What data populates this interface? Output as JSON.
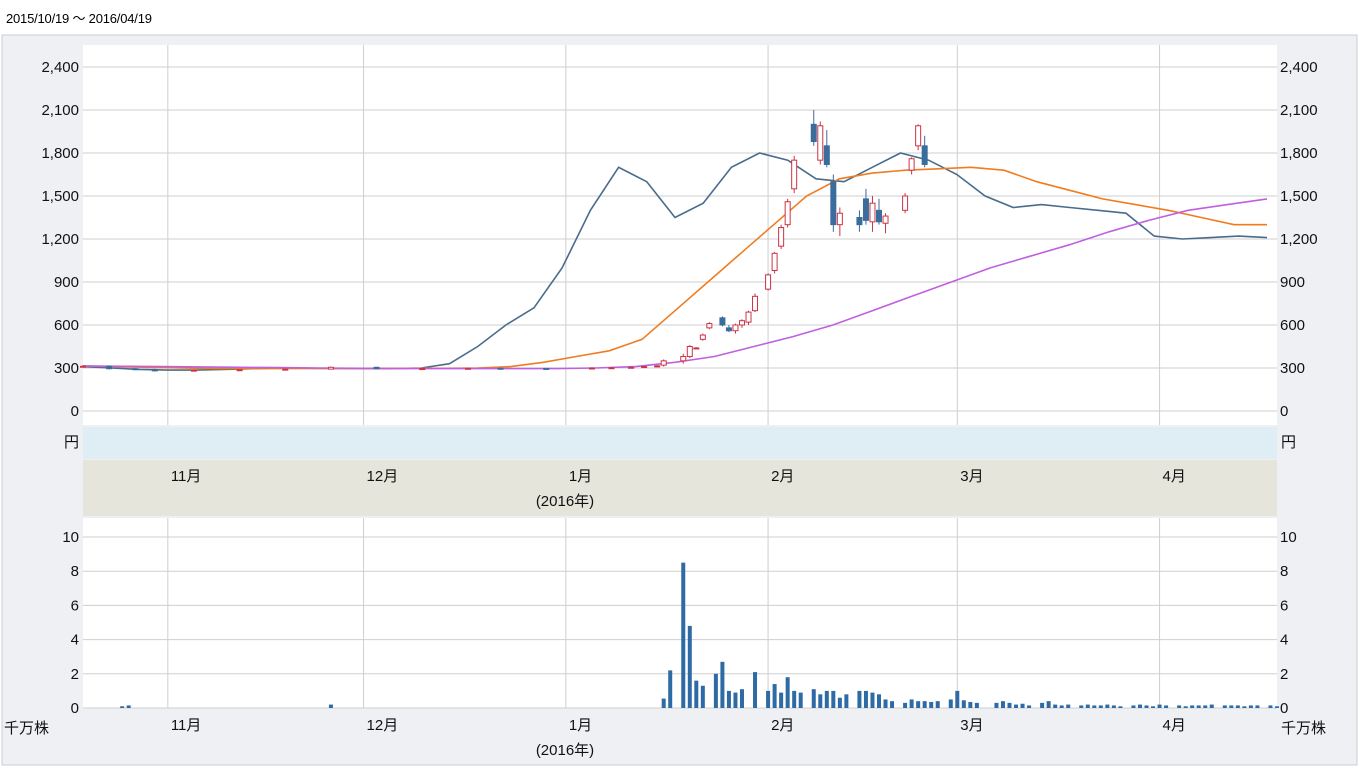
{
  "header": {
    "date_range": "2015/10/19 ～ 2016/04/19"
  },
  "chart_data": [
    {
      "type": "candlestick",
      "title": "",
      "ylabel": "円",
      "ylim": [
        0,
        2400
      ],
      "y_ticks": [
        "0",
        "300",
        "600",
        "900",
        "1,200",
        "1,500",
        "1,800",
        "2,100",
        "2,400"
      ],
      "y_tick_values": [
        0,
        300,
        600,
        900,
        1200,
        1500,
        1800,
        2100,
        2400
      ],
      "x_range": [
        "2015-10-19",
        "2016-04-19"
      ],
      "month_labels": [
        {
          "date": "2015-11-01",
          "label": "11月"
        },
        {
          "date": "2015-12-01",
          "label": "12月"
        },
        {
          "date": "2016-01-01",
          "label": "1月"
        },
        {
          "date": "2016-02-01",
          "label": "2月"
        },
        {
          "date": "2016-03-01",
          "label": "3月"
        },
        {
          "date": "2016-04-01",
          "label": "4月"
        }
      ],
      "year_label": "(2016年)",
      "grid": true,
      "up_color": "#cc3344",
      "down_color": "#3a6c9c",
      "candles": [
        [
          "2015-10-19",
          310,
          320,
          305,
          312
        ],
        [
          "2015-10-23",
          312,
          318,
          290,
          295
        ],
        [
          "2015-10-27",
          295,
          300,
          285,
          290
        ],
        [
          "2015-10-30",
          290,
          295,
          275,
          280
        ],
        [
          "2015-11-05",
          280,
          290,
          275,
          285
        ],
        [
          "2015-11-12",
          285,
          290,
          280,
          288
        ],
        [
          "2015-11-19",
          288,
          295,
          285,
          292
        ],
        [
          "2015-11-26",
          292,
          310,
          290,
          305
        ],
        [
          "2015-12-03",
          305,
          308,
          290,
          295
        ],
        [
          "2015-12-10",
          295,
          300,
          290,
          296
        ],
        [
          "2015-12-17",
          296,
          300,
          292,
          298
        ],
        [
          "2015-12-22",
          298,
          302,
          294,
          297
        ],
        [
          "2015-12-29",
          297,
          300,
          290,
          295
        ],
        [
          "2016-01-05",
          295,
          305,
          290,
          300
        ],
        [
          "2016-01-08",
          300,
          305,
          295,
          302
        ],
        [
          "2016-01-11",
          302,
          310,
          298,
          305
        ],
        [
          "2016-01-13",
          305,
          315,
          300,
          310
        ],
        [
          "2016-01-15",
          310,
          320,
          305,
          315
        ],
        [
          "2016-01-16",
          320,
          360,
          310,
          350
        ],
        [
          "2016-01-19",
          350,
          400,
          330,
          380
        ],
        [
          "2016-01-20",
          380,
          460,
          370,
          450
        ],
        [
          "2016-01-21",
          440,
          445,
          435,
          440
        ],
        [
          "2016-01-22",
          500,
          540,
          490,
          530
        ],
        [
          "2016-01-23",
          580,
          620,
          570,
          610
        ],
        [
          "2016-01-25",
          650,
          660,
          590,
          600
        ],
        [
          "2016-01-26",
          580,
          600,
          550,
          560
        ],
        [
          "2016-01-27",
          560,
          610,
          540,
          600
        ],
        [
          "2016-01-28",
          600,
          640,
          580,
          630
        ],
        [
          "2016-01-29",
          620,
          700,
          600,
          690
        ],
        [
          "2016-01-30",
          700,
          820,
          690,
          800
        ],
        [
          "2016-02-01",
          850,
          960,
          840,
          950
        ],
        [
          "2016-02-02",
          980,
          1110,
          960,
          1100
        ],
        [
          "2016-02-03",
          1150,
          1300,
          1130,
          1280
        ],
        [
          "2016-02-04",
          1300,
          1480,
          1280,
          1460
        ],
        [
          "2016-02-05",
          1550,
          1780,
          1520,
          1750
        ],
        [
          "2016-02-08",
          2000,
          2100,
          1850,
          1880
        ],
        [
          "2016-02-09",
          1750,
          2020,
          1720,
          1990
        ],
        [
          "2016-02-10",
          1850,
          1960,
          1700,
          1720
        ],
        [
          "2016-02-11",
          1600,
          1650,
          1250,
          1300
        ],
        [
          "2016-02-12",
          1300,
          1420,
          1220,
          1380
        ],
        [
          "2016-02-15",
          1350,
          1400,
          1250,
          1300
        ],
        [
          "2016-02-16",
          1480,
          1550,
          1300,
          1330
        ],
        [
          "2016-02-17",
          1320,
          1500,
          1250,
          1450
        ],
        [
          "2016-02-18",
          1400,
          1480,
          1300,
          1320
        ],
        [
          "2016-02-19",
          1310,
          1380,
          1240,
          1360
        ],
        [
          "2016-02-22",
          1400,
          1520,
          1380,
          1500
        ],
        [
          "2016-02-23",
          1680,
          1770,
          1650,
          1760
        ],
        [
          "2016-02-24",
          1850,
          2000,
          1820,
          1990
        ],
        [
          "2016-02-25",
          1850,
          1920,
          1700,
          1720
        ]
      ],
      "candles_note": "",
      "moving_averages": [
        {
          "color": "#4a6c8c",
          "values": [
            310,
            300,
            290,
            285,
            285,
            290,
            295,
            300,
            298,
            297,
            296,
            296,
            300,
            330,
            450,
            600,
            720,
            1000,
            1400,
            1700,
            1600,
            1350,
            1450,
            1700,
            1800,
            1750,
            1620,
            1600,
            1700,
            1800,
            1750,
            1650,
            1500,
            1420,
            1440,
            1420,
            1400,
            1380,
            1220,
            1200,
            1210,
            1220,
            1210
          ]
        },
        {
          "color": "#f07c20",
          "values": [
            315,
            310,
            305,
            300,
            296,
            296,
            296,
            297,
            297,
            297,
            298,
            298,
            300,
            310,
            340,
            380,
            420,
            500,
            700,
            900,
            1100,
            1300,
            1500,
            1620,
            1660,
            1680,
            1690,
            1700,
            1680,
            1600,
            1540,
            1480,
            1440,
            1400,
            1350,
            1300,
            1300
          ]
        },
        {
          "color": "#c060e0",
          "values": [
            315,
            312,
            310,
            308,
            305,
            303,
            300,
            298,
            296,
            296,
            296,
            296,
            296,
            300,
            310,
            340,
            380,
            450,
            520,
            600,
            700,
            800,
            900,
            1000,
            1080,
            1160,
            1250,
            1330,
            1400,
            1440,
            1480
          ]
        }
      ]
    },
    {
      "type": "bar",
      "title": "",
      "ylabel": "千万株",
      "ylim": [
        0,
        10
      ],
      "y_ticks": [
        "0",
        "2",
        "4",
        "6",
        "8",
        "10"
      ],
      "y_tick_values": [
        0,
        2,
        4,
        6,
        8,
        10
      ],
      "bar_color": "#2e6aa3",
      "dates": [
        "2015-10-25",
        "2015-10-26",
        "2015-11-26",
        "2016-01-16",
        "2016-01-17",
        "2016-01-19",
        "2016-01-20",
        "2016-01-21",
        "2016-01-22",
        "2016-01-24",
        "2016-01-25",
        "2016-01-26",
        "2016-01-27",
        "2016-01-28",
        "2016-01-30",
        "2016-02-01",
        "2016-02-02",
        "2016-02-03",
        "2016-02-04",
        "2016-02-05",
        "2016-02-06",
        "2016-02-08",
        "2016-02-09",
        "2016-02-10",
        "2016-02-11",
        "2016-02-12",
        "2016-02-13",
        "2016-02-15",
        "2016-02-16",
        "2016-02-17",
        "2016-02-18",
        "2016-02-19",
        "2016-02-20",
        "2016-02-22",
        "2016-02-23",
        "2016-02-24",
        "2016-02-25",
        "2016-02-26",
        "2016-02-27",
        "2016-02-29",
        "2016-03-01",
        "2016-03-02",
        "2016-03-03",
        "2016-03-04",
        "2016-03-07",
        "2016-03-08",
        "2016-03-09",
        "2016-03-10",
        "2016-03-11",
        "2016-03-12",
        "2016-03-14",
        "2016-03-15",
        "2016-03-16",
        "2016-03-17",
        "2016-03-18",
        "2016-03-20",
        "2016-03-21",
        "2016-03-22",
        "2016-03-23",
        "2016-03-24",
        "2016-03-25",
        "2016-03-26",
        "2016-03-28",
        "2016-03-29",
        "2016-03-30",
        "2016-03-31",
        "2016-04-01",
        "2016-04-02",
        "2016-04-04",
        "2016-04-05",
        "2016-04-06",
        "2016-04-07",
        "2016-04-08",
        "2016-04-09",
        "2016-04-11",
        "2016-04-12",
        "2016-04-13",
        "2016-04-14",
        "2016-04-15",
        "2016-04-16",
        "2016-04-18",
        "2016-04-19"
      ],
      "values": [
        0.1,
        0.15,
        0.2,
        0.55,
        2.2,
        8.5,
        4.8,
        1.6,
        1.3,
        2.0,
        2.7,
        1.0,
        0.9,
        1.1,
        2.1,
        1.0,
        1.4,
        0.9,
        1.8,
        1.0,
        0.9,
        1.1,
        0.8,
        1.0,
        1.0,
        0.6,
        0.8,
        1.0,
        1.0,
        0.9,
        0.8,
        0.5,
        0.4,
        0.3,
        0.5,
        0.4,
        0.4,
        0.35,
        0.4,
        0.5,
        1.0,
        0.45,
        0.35,
        0.3,
        0.3,
        0.4,
        0.3,
        0.2,
        0.25,
        0.15,
        0.3,
        0.4,
        0.2,
        0.15,
        0.2,
        0.15,
        0.2,
        0.15,
        0.15,
        0.2,
        0.15,
        0.1,
        0.15,
        0.2,
        0.15,
        0.1,
        0.2,
        0.15,
        0.15,
        0.1,
        0.15,
        0.15,
        0.15,
        0.2,
        0.15,
        0.15,
        0.15,
        0.1,
        0.15,
        0.15,
        0.15,
        0.1
      ],
      "month_labels": [
        {
          "date": "2015-11-01",
          "label": "11月"
        },
        {
          "date": "2015-12-01",
          "label": "12月"
        },
        {
          "date": "2016-01-01",
          "label": "1月"
        },
        {
          "date": "2016-02-01",
          "label": "2月"
        },
        {
          "date": "2016-03-01",
          "label": "3月"
        },
        {
          "date": "2016-04-01",
          "label": "4月"
        }
      ],
      "year_label": "(2016年)",
      "grid": true
    }
  ]
}
